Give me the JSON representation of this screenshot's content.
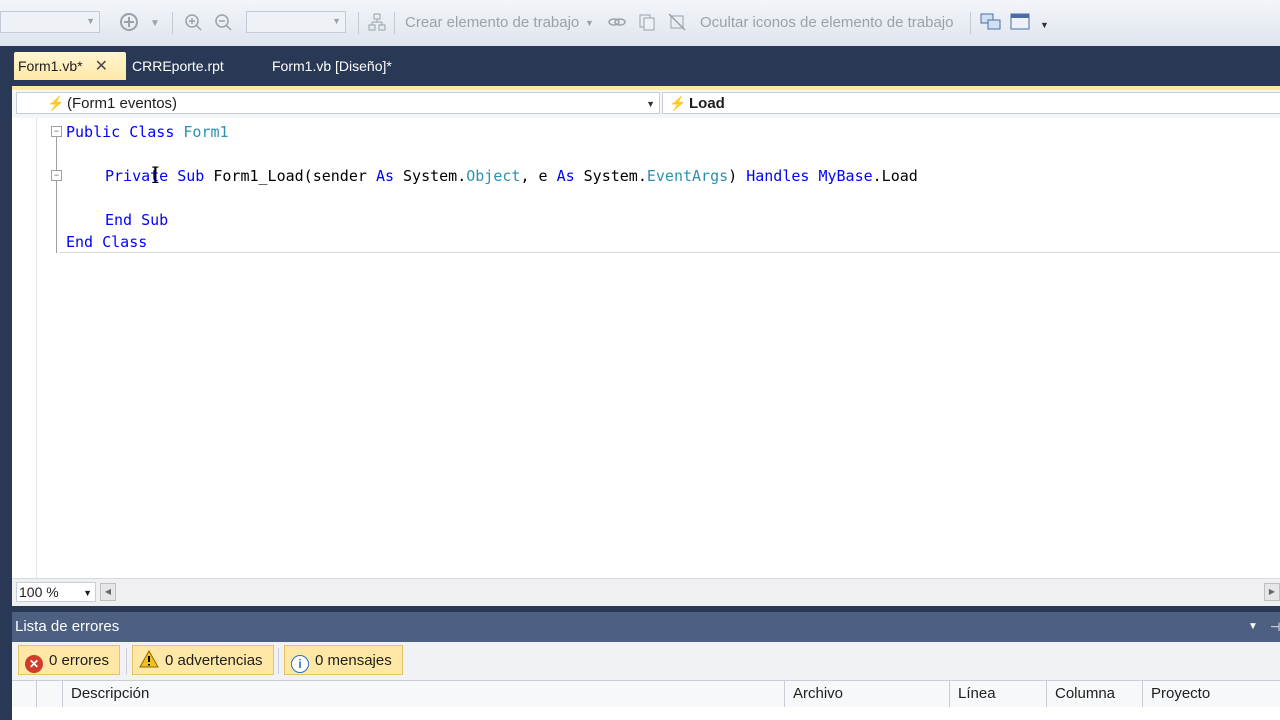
{
  "toolbar": {
    "create_work_item": "Crear elemento de trabajo",
    "hide_icons": "Ocultar iconos de elemento de trabajo"
  },
  "tabs": [
    {
      "label": "Form1.vb*",
      "active": true
    },
    {
      "label": "CRREporte.rpt",
      "active": false
    },
    {
      "label": "Form1.vb [Diseño]*",
      "active": false
    }
  ],
  "navbar": {
    "object": "(Form1 eventos)",
    "member": "Load"
  },
  "code": {
    "line1": {
      "kw1": "Public",
      "kw2": "Class",
      "name": "Form1"
    },
    "line2": {
      "kw_private": "Private",
      "kw_sub": "Sub",
      "method": "Form1_Load(sender",
      "kw_as1": "As",
      "sys1": "System.",
      "type1": "Object",
      "comma": ", e",
      "kw_as2": "As",
      "sys2": "System.",
      "type2": "EventArgs",
      "close": ")",
      "kw_handles": "Handles",
      "kw_mybase": "MyBase",
      "evt": ".Load"
    },
    "line3": {
      "kw1": "End",
      "kw2": "Sub"
    },
    "line4": {
      "kw1": "End",
      "kw2": "Class"
    }
  },
  "zoom": "100 %",
  "error_list": {
    "title": "Lista de errores",
    "filters": {
      "errors": "0 errores",
      "warnings": "0 advertencias",
      "messages": "0 mensajes"
    },
    "columns": [
      "Descripción",
      "Archivo",
      "Línea",
      "Columna",
      "Proyecto"
    ]
  },
  "colors": {
    "chrome": "#293955",
    "active_tab": "#ffe8a6",
    "keyword": "#0000ff",
    "type": "#2b91af"
  }
}
